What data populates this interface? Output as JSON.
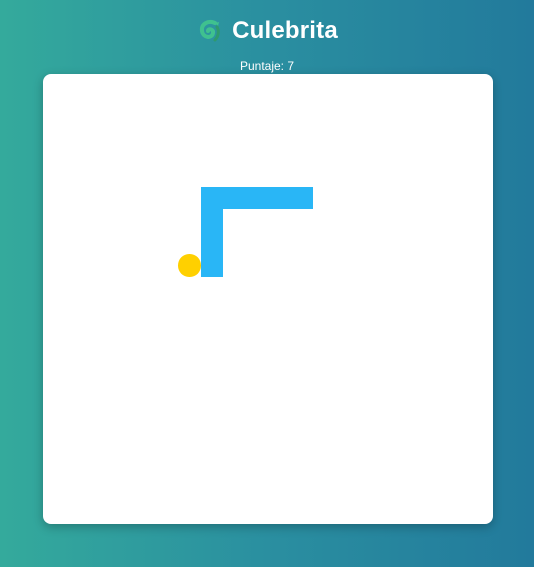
{
  "header": {
    "logo_icon": "snake-icon",
    "title": "Culebrita"
  },
  "score": {
    "text": "Puntaje: 7"
  },
  "game": {
    "grid_size": 20,
    "snake_color": "#29b6f6",
    "food_color": "#ffd000",
    "snake_cells": [
      [
        11,
        5
      ],
      [
        10,
        5
      ],
      [
        9,
        5
      ],
      [
        8,
        5
      ],
      [
        7,
        5
      ],
      [
        7,
        6
      ],
      [
        7,
        7
      ],
      [
        7,
        8
      ]
    ],
    "food_cell": [
      6,
      8
    ]
  },
  "colors": {
    "background_start": "#34aa9c",
    "background_end": "#227a9c",
    "board": "#ffffff"
  }
}
